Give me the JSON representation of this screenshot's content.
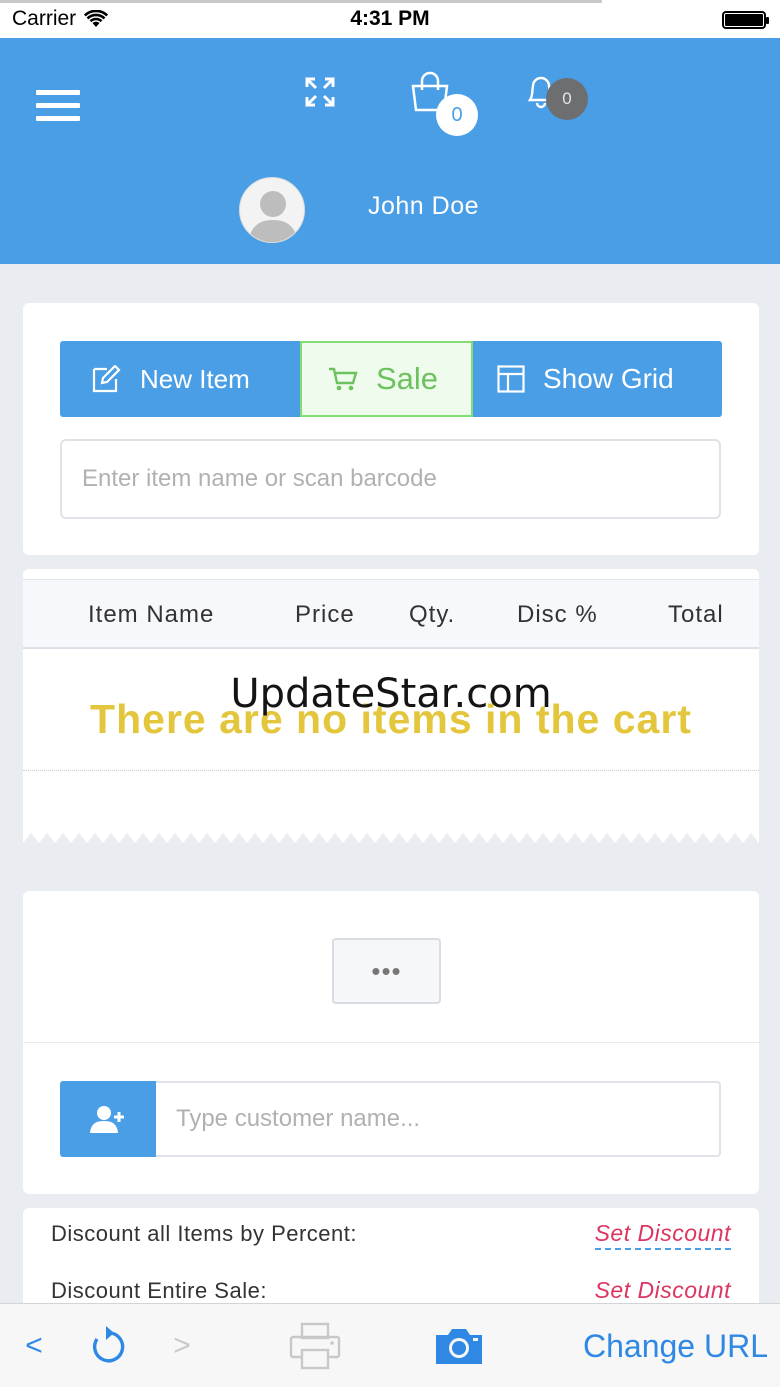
{
  "status_bar": {
    "carrier": "Carrier",
    "time": "4:31 PM"
  },
  "header": {
    "cart_count": "0",
    "notification_count": "0",
    "user_name": "John Doe"
  },
  "actions": {
    "new_item": "New Item",
    "sale": "Sale",
    "show_grid": "Show Grid"
  },
  "search": {
    "placeholder": "Enter item name or scan barcode"
  },
  "cart_table": {
    "columns": [
      "Item Name",
      "Price",
      "Qty.",
      "Disc %",
      "Total"
    ],
    "empty_message": "There are no items in the cart",
    "watermark": "UpdateStar.com"
  },
  "more_button": "•••",
  "customer": {
    "placeholder": "Type customer name..."
  },
  "discounts": [
    {
      "label": "Discount all Items by Percent:",
      "action": "Set Discount"
    },
    {
      "label": "Discount Entire Sale:",
      "action": "Set Discount"
    }
  ],
  "toolbar": {
    "back": "<",
    "forward": ">",
    "change_url": "Change URL"
  },
  "colors": {
    "primary": "#4a9ee6",
    "sale_green": "#6cc25c",
    "empty_text": "#e4c63c",
    "discount_link": "#dc3560"
  }
}
